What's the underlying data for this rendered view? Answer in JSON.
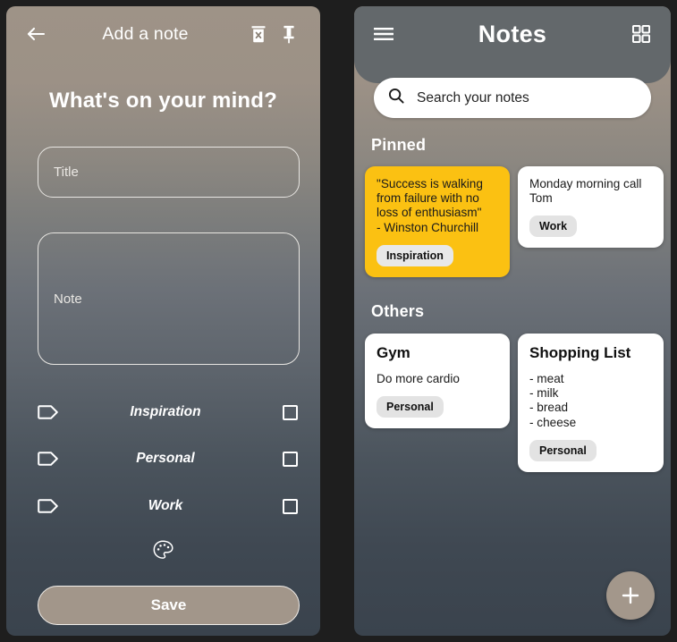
{
  "left_screen": {
    "topbar": {
      "back_icon": "arrow-left-icon",
      "title": "Add a note",
      "delete_icon": "trash-delete-icon",
      "pin_icon": "pin-icon"
    },
    "heading": "What's on your mind?",
    "title_field": {
      "placeholder": "Title",
      "value": ""
    },
    "note_field": {
      "placeholder": "Note",
      "value": ""
    },
    "tags": [
      {
        "icon": "tag-icon",
        "label": "Inspiration",
        "checked": false
      },
      {
        "icon": "tag-icon",
        "label": "Personal",
        "checked": false
      },
      {
        "icon": "tag-icon",
        "label": "Work",
        "checked": false
      }
    ],
    "palette_icon": "color-palette-icon",
    "save_label": "Save"
  },
  "right_screen": {
    "header": {
      "menu_icon": "hamburger-menu-icon",
      "title": "Notes",
      "grid_icon": "grid-view-icon"
    },
    "search": {
      "icon": "search-icon",
      "placeholder": "Search your notes",
      "value": ""
    },
    "sections": [
      {
        "label": "Pinned",
        "notes": [
          {
            "title": "",
            "body": "\"Success is walking\nfrom failure with no\nloss of enthusiasm\"\n- Winston Churchill",
            "chip": "Inspiration",
            "color": "#fbc112"
          },
          {
            "title": "",
            "body": "Monday morning call\nTom",
            "chip": "Work",
            "color": "#ffffff"
          }
        ]
      },
      {
        "label": "Others",
        "notes": [
          {
            "title": "Gym",
            "body": "Do more cardio",
            "chip": "Personal",
            "color": "#ffffff"
          },
          {
            "title": "Shopping List",
            "body": "- meat\n- milk\n- bread\n- cheese",
            "chip": "Personal",
            "color": "#ffffff"
          }
        ]
      }
    ],
    "fab": {
      "icon": "plus-icon",
      "label": "+"
    }
  },
  "colors": {
    "accent_yellow": "#fbc112",
    "button_taupe": "#a2968a",
    "header_gray": "#63686b",
    "chip_gray": "#e3e3e3"
  }
}
